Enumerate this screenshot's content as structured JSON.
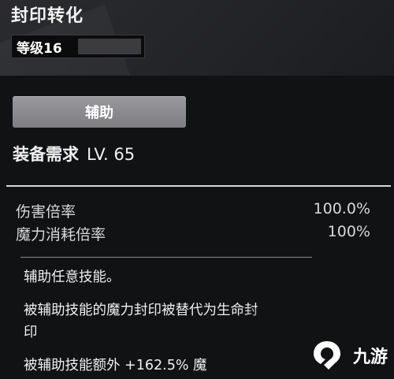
{
  "header": {
    "title": "封印转化",
    "level_label": "等级16",
    "level_progress": 0.0
  },
  "support_button": {
    "label": "辅助"
  },
  "requirement": {
    "label": "装备需求",
    "value": "LV. 65"
  },
  "stats": [
    {
      "label": "伤害倍率",
      "value": "100.0%"
    },
    {
      "label": "魔力消耗倍率",
      "value": "100%"
    }
  ],
  "description": {
    "line1": "辅助任意技能。",
    "line2a": "被辅助技能的魔力封印被替代为生命封",
    "line2b": "印",
    "line3": "被辅助技能额外 +162.5% 魔"
  },
  "watermark": {
    "text": "九游",
    "icon": "nine-game-logo"
  },
  "colors": {
    "background": "#111214",
    "button": "#8c8c90",
    "text": "#e8e8e8"
  }
}
